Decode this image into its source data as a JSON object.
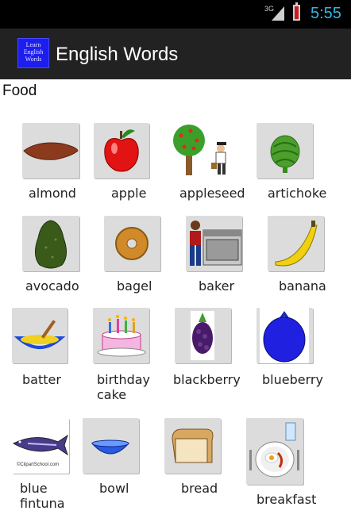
{
  "status": {
    "network": "3G",
    "time": "5:55"
  },
  "app": {
    "icon_text": [
      "Learn",
      "English",
      "Words"
    ],
    "title": "English Words"
  },
  "category": "Food",
  "words": [
    "almond",
    "apple",
    "appleseed",
    "artichoke",
    "avocado",
    "bagel",
    "baker",
    "banana",
    "batter",
    "birthday cake",
    "blackberry",
    "blueberry",
    "blue fintuna",
    "bowl",
    "bread",
    "breakfast"
  ],
  "labels": {
    "almond": "almond",
    "apple": "apple",
    "appleseed": "appleseed",
    "artichoke": "artichoke",
    "avocado": "avocado",
    "bagel": "bagel",
    "baker": "baker",
    "banana": "banana",
    "batter": "batter",
    "birthday_cake_1": "birthday",
    "birthday_cake_2": "cake",
    "blackberry": "blackberry",
    "blueberry": "blueberry",
    "blue_fintuna_1": "blue",
    "blue_fintuna_2": "fintuna",
    "bowl": "bowl",
    "bread": "bread",
    "breakfast": "breakfast"
  },
  "image_texts": {
    "fish_caption": "©ClipartSchool.com"
  }
}
